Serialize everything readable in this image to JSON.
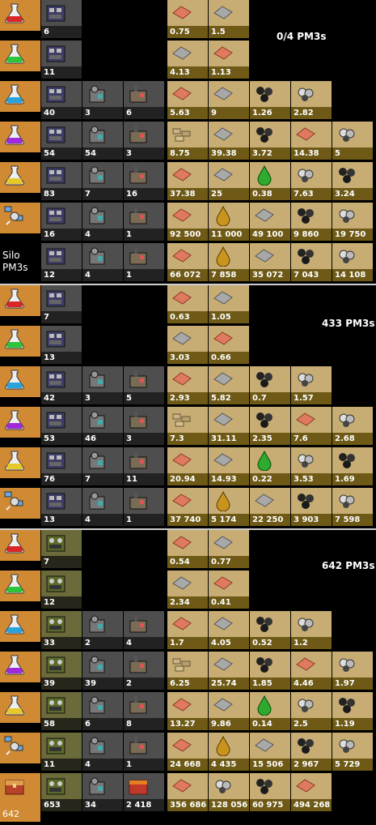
{
  "section_labels": [
    "0/4 PM3s",
    "433 PM3s",
    "642 PM3s"
  ],
  "silo_label": [
    "Silo",
    "PM3s"
  ],
  "rocket_count": "642",
  "colors": {
    "science_bg": "#d08a34",
    "building_bg": "#4e4e4e",
    "resource_bg": "#c7ad74",
    "resource_strip": "#6e5a16"
  },
  "sections": [
    {
      "rows": [
        {
          "science": "red-science-icon",
          "buildings": [
            {
              "icon": "assembler-icon",
              "v": "6"
            }
          ],
          "resources": [
            {
              "icon": "copper-plate-icon",
              "v": "0.75"
            },
            {
              "icon": "iron-plate-icon",
              "v": "1.5"
            }
          ]
        },
        {
          "science": "green-science-icon",
          "buildings": [
            {
              "icon": "assembler-icon",
              "v": "11"
            }
          ],
          "resources": [
            {
              "icon": "iron-plate-icon",
              "v": "4.13"
            },
            {
              "icon": "copper-plate-icon",
              "v": "1.13"
            }
          ]
        },
        {
          "science": "blue-science-icon",
          "buildings": [
            {
              "icon": "assembler-icon",
              "v": "40"
            },
            {
              "icon": "chem-plant-icon",
              "v": "3"
            },
            {
              "icon": "refinery-icon",
              "v": "6"
            }
          ],
          "resources": [
            {
              "icon": "copper-plate-icon",
              "v": "5.63"
            },
            {
              "icon": "iron-plate-icon",
              "v": "9"
            },
            {
              "icon": "coal-icon",
              "v": "1.26"
            },
            {
              "icon": "stone-icon",
              "v": "2.82"
            }
          ]
        },
        {
          "science": "purple-science-icon",
          "buildings": [
            {
              "icon": "assembler-icon",
              "v": "54"
            },
            {
              "icon": "chem-plant-icon",
              "v": "54"
            },
            {
              "icon": "refinery-icon",
              "v": "3"
            }
          ],
          "resources": [
            {
              "icon": "stone-brick-icon",
              "v": "8.75"
            },
            {
              "icon": "iron-plate-icon",
              "v": "39.38"
            },
            {
              "icon": "coal-icon",
              "v": "3.72"
            },
            {
              "icon": "copper-plate-icon",
              "v": "14.38"
            },
            {
              "icon": "stone-icon",
              "v": "5"
            }
          ]
        },
        {
          "science": "yellow-science-icon",
          "buildings": [
            {
              "icon": "assembler-icon",
              "v": "83"
            },
            {
              "icon": "chem-plant-icon",
              "v": "7"
            },
            {
              "icon": "refinery-icon",
              "v": "16"
            }
          ],
          "resources": [
            {
              "icon": "copper-plate-icon",
              "v": "37.38"
            },
            {
              "icon": "iron-plate-icon",
              "v": "25"
            },
            {
              "icon": "sulfuric-acid-icon",
              "v": "0.38"
            },
            {
              "icon": "stone-icon",
              "v": "7.63"
            },
            {
              "icon": "coal-icon",
              "v": "3.24"
            }
          ]
        },
        {
          "science": "satellite-icon",
          "buildings": [
            {
              "icon": "assembler-icon",
              "v": "16"
            },
            {
              "icon": "chem-plant-icon",
              "v": "4"
            },
            {
              "icon": "refinery-icon",
              "v": "1"
            }
          ],
          "resources": [
            {
              "icon": "copper-plate-icon",
              "v": "92 500"
            },
            {
              "icon": "crude-oil-icon",
              "v": "11 000"
            },
            {
              "icon": "iron-plate-icon",
              "v": "49 100"
            },
            {
              "icon": "coal-icon",
              "v": "9 860"
            },
            {
              "icon": "stone-icon",
              "v": "19 750"
            }
          ]
        },
        {
          "science": "silo-label",
          "buildings": [
            {
              "icon": "assembler-icon",
              "v": "12"
            },
            {
              "icon": "chem-plant-icon",
              "v": "4"
            },
            {
              "icon": "refinery-icon",
              "v": "1"
            }
          ],
          "resources": [
            {
              "icon": "copper-plate-icon",
              "v": "66 072"
            },
            {
              "icon": "crude-oil-icon",
              "v": "7 858"
            },
            {
              "icon": "iron-plate-icon",
              "v": "35 072"
            },
            {
              "icon": "coal-icon",
              "v": "7 043"
            },
            {
              "icon": "stone-icon",
              "v": "14 108"
            }
          ]
        }
      ]
    },
    {
      "rows": [
        {
          "science": "red-science-icon",
          "buildings": [
            {
              "icon": "assembler-icon",
              "v": "7"
            }
          ],
          "resources": [
            {
              "icon": "copper-plate-icon",
              "v": "0.63"
            },
            {
              "icon": "iron-plate-icon",
              "v": "1.05"
            }
          ]
        },
        {
          "science": "green-science-icon",
          "buildings": [
            {
              "icon": "assembler-icon",
              "v": "13"
            }
          ],
          "resources": [
            {
              "icon": "iron-plate-icon",
              "v": "3.03"
            },
            {
              "icon": "copper-plate-icon",
              "v": "0.66"
            }
          ]
        },
        {
          "science": "blue-science-icon",
          "buildings": [
            {
              "icon": "assembler-icon",
              "v": "42"
            },
            {
              "icon": "chem-plant-icon",
              "v": "3"
            },
            {
              "icon": "refinery-icon",
              "v": "5"
            }
          ],
          "resources": [
            {
              "icon": "copper-plate-icon",
              "v": "2.93"
            },
            {
              "icon": "iron-plate-icon",
              "v": "5.82"
            },
            {
              "icon": "coal-icon",
              "v": "0.7"
            },
            {
              "icon": "stone-icon",
              "v": "1.57"
            }
          ]
        },
        {
          "science": "purple-science-icon",
          "buildings": [
            {
              "icon": "assembler-icon",
              "v": "53"
            },
            {
              "icon": "chem-plant-icon",
              "v": "46"
            },
            {
              "icon": "refinery-icon",
              "v": "3"
            }
          ],
          "resources": [
            {
              "icon": "stone-brick-icon",
              "v": "7.3"
            },
            {
              "icon": "iron-plate-icon",
              "v": "31.11"
            },
            {
              "icon": "coal-icon",
              "v": "2.35"
            },
            {
              "icon": "copper-plate-icon",
              "v": "7.6"
            },
            {
              "icon": "stone-icon",
              "v": "2.68"
            }
          ]
        },
        {
          "science": "yellow-science-icon",
          "buildings": [
            {
              "icon": "assembler-icon",
              "v": "76"
            },
            {
              "icon": "chem-plant-icon",
              "v": "7"
            },
            {
              "icon": "refinery-icon",
              "v": "11"
            }
          ],
          "resources": [
            {
              "icon": "copper-plate-icon",
              "v": "20.94"
            },
            {
              "icon": "iron-plate-icon",
              "v": "14.93"
            },
            {
              "icon": "sulfuric-acid-icon",
              "v": "0.22"
            },
            {
              "icon": "stone-icon",
              "v": "3.53"
            },
            {
              "icon": "coal-icon",
              "v": "1.69"
            }
          ]
        },
        {
          "science": "satellite-icon",
          "buildings": [
            {
              "icon": "assembler-icon",
              "v": "13"
            },
            {
              "icon": "chem-plant-icon",
              "v": "4"
            },
            {
              "icon": "refinery-icon",
              "v": "1"
            }
          ],
          "resources": [
            {
              "icon": "copper-plate-icon",
              "v": "37 740"
            },
            {
              "icon": "crude-oil-icon",
              "v": "5 174"
            },
            {
              "icon": "iron-plate-icon",
              "v": "22 250"
            },
            {
              "icon": "coal-icon",
              "v": "3 903"
            },
            {
              "icon": "stone-icon",
              "v": "7 598"
            }
          ]
        }
      ]
    },
    {
      "rows": [
        {
          "science": "red-science-icon",
          "buildings": [
            {
              "icon": "assembler3-icon",
              "v": "7"
            }
          ],
          "resources": [
            {
              "icon": "copper-plate-icon",
              "v": "0.54"
            },
            {
              "icon": "iron-plate-icon",
              "v": "0.77"
            }
          ]
        },
        {
          "science": "green-science-icon",
          "buildings": [
            {
              "icon": "assembler3-icon",
              "v": "12"
            }
          ],
          "resources": [
            {
              "icon": "iron-plate-icon",
              "v": "2.34"
            },
            {
              "icon": "copper-plate-icon",
              "v": "0.41"
            }
          ]
        },
        {
          "science": "blue-science-icon",
          "buildings": [
            {
              "icon": "assembler3-icon",
              "v": "33"
            },
            {
              "icon": "chem-plant-icon",
              "v": "2"
            },
            {
              "icon": "refinery-icon",
              "v": "4"
            }
          ],
          "resources": [
            {
              "icon": "copper-plate-icon",
              "v": "1.7"
            },
            {
              "icon": "iron-plate-icon",
              "v": "4.05"
            },
            {
              "icon": "coal-icon",
              "v": "0.52"
            },
            {
              "icon": "stone-icon",
              "v": "1.2"
            }
          ]
        },
        {
          "science": "purple-science-icon",
          "buildings": [
            {
              "icon": "assembler3-icon",
              "v": "39"
            },
            {
              "icon": "chem-plant-icon",
              "v": "39"
            },
            {
              "icon": "refinery-icon",
              "v": "2"
            }
          ],
          "resources": [
            {
              "icon": "stone-brick-icon",
              "v": "6.25"
            },
            {
              "icon": "iron-plate-icon",
              "v": "25.74"
            },
            {
              "icon": "coal-icon",
              "v": "1.85"
            },
            {
              "icon": "copper-plate-icon",
              "v": "4.46"
            },
            {
              "icon": "stone-icon",
              "v": "1.97"
            }
          ]
        },
        {
          "science": "yellow-science-icon",
          "buildings": [
            {
              "icon": "assembler3-icon",
              "v": "58"
            },
            {
              "icon": "chem-plant-icon",
              "v": "6"
            },
            {
              "icon": "refinery-icon",
              "v": "8"
            }
          ],
          "resources": [
            {
              "icon": "copper-plate-icon",
              "v": "13.27"
            },
            {
              "icon": "iron-plate-icon",
              "v": "9.86"
            },
            {
              "icon": "sulfuric-acid-icon",
              "v": "0.14"
            },
            {
              "icon": "stone-icon",
              "v": "2.5"
            },
            {
              "icon": "coal-icon",
              "v": "1.19"
            }
          ]
        },
        {
          "science": "satellite-icon",
          "buildings": [
            {
              "icon": "assembler3-icon",
              "v": "11"
            },
            {
              "icon": "chem-plant-icon",
              "v": "4"
            },
            {
              "icon": "refinery-icon",
              "v": "1"
            }
          ],
          "resources": [
            {
              "icon": "copper-plate-icon",
              "v": "24 668"
            },
            {
              "icon": "crude-oil-icon",
              "v": "4 435"
            },
            {
              "icon": "iron-plate-icon",
              "v": "15 506"
            },
            {
              "icon": "coal-icon",
              "v": "2 967"
            },
            {
              "icon": "stone-icon",
              "v": "5 729"
            }
          ]
        },
        {
          "science": "rocket-chest-icon",
          "buildings": [
            {
              "icon": "assembler3-icon",
              "v": "653"
            },
            {
              "icon": "chem-plant-icon",
              "v": "34"
            },
            {
              "icon": "chest-red-icon",
              "v": "2 418"
            }
          ],
          "resources": [
            {
              "icon": "copper-plate-icon",
              "v": "356 686"
            },
            {
              "icon": "stone-icon",
              "v": "128 056"
            },
            {
              "icon": "coal-icon",
              "v": "60 975"
            },
            {
              "icon": "copper-plate-icon",
              "v": "494 268"
            }
          ]
        }
      ]
    }
  ]
}
